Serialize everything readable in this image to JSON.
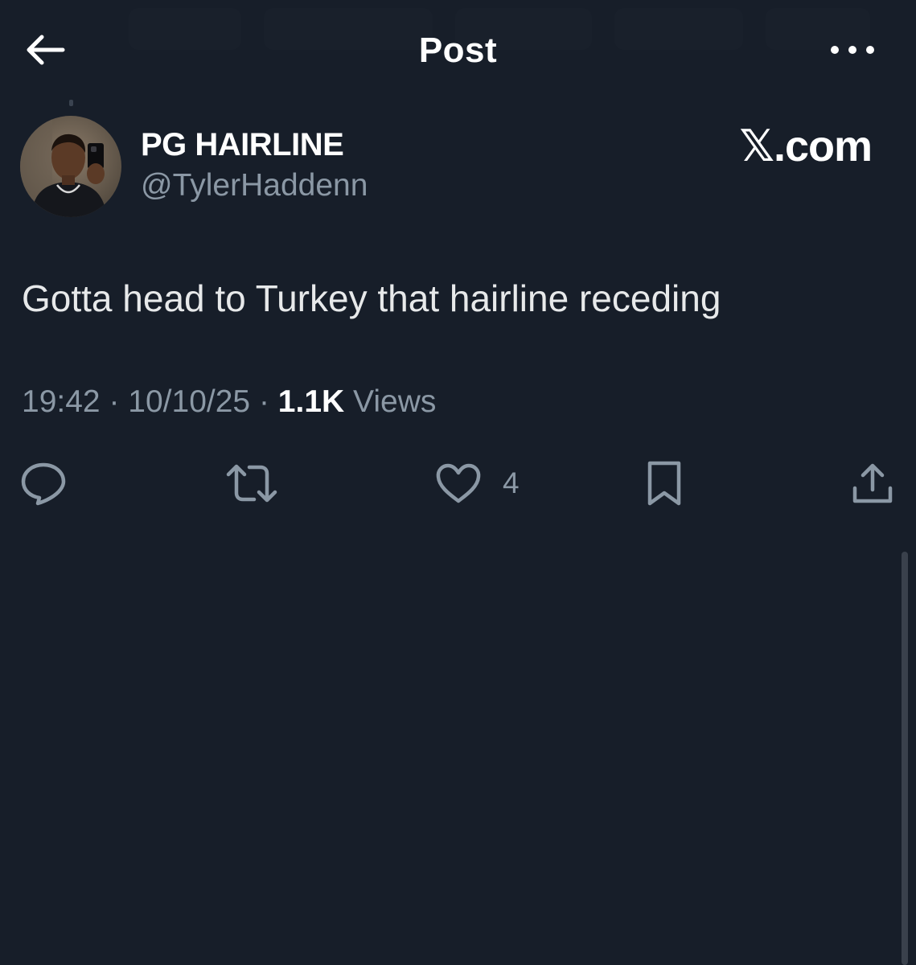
{
  "header": {
    "title": "Post"
  },
  "author": {
    "display_name": "PG HAIRLINE",
    "handle": "@TylerHaddenn"
  },
  "watermark": "𝕏.com",
  "post": {
    "text": "Gotta head to Turkey that hairline receding",
    "time": "19:42",
    "date": "10/10/25",
    "views_count": "1.1K",
    "views_label": "Views",
    "separator": "·"
  },
  "actions": {
    "reply_count": "",
    "repost_count": "",
    "like_count": "4",
    "bookmark_count": ""
  },
  "colors": {
    "background": "#171e29",
    "primary_text": "#e7e9ea",
    "secondary_text": "#8b98a5"
  }
}
